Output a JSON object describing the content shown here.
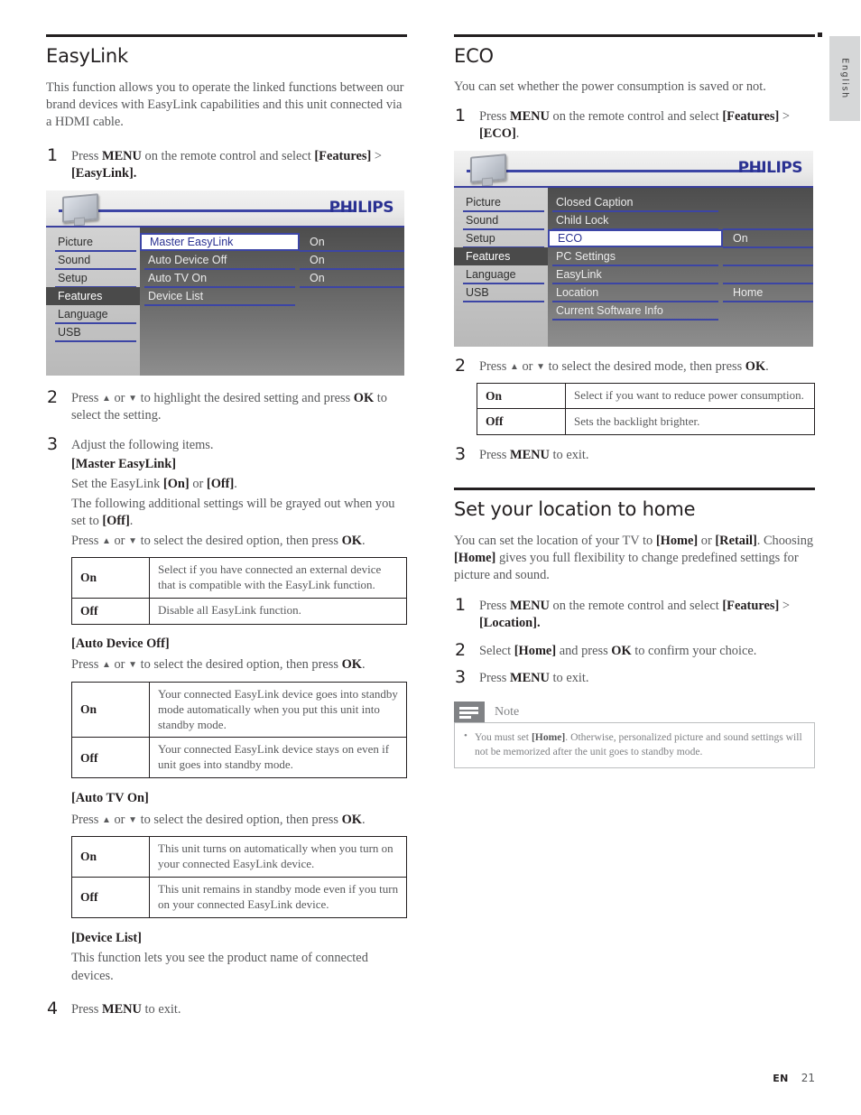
{
  "page": {
    "language_tab": "English",
    "footer_lang": "EN",
    "footer_page": "21"
  },
  "left_column": {
    "section_title": "EasyLink",
    "intro": "This function allows you to operate the linked functions between our brand devices with EasyLink capabilities and this unit connected via a HDMI cable.",
    "step1": {
      "num": "1",
      "text_1": "Press ",
      "menu": "MENU",
      "text_2": " on the remote control and select ",
      "features": "[Features]",
      "text_3": " > ",
      "easylink": "[EasyLink]."
    },
    "osd": {
      "brand": "PHILIPS",
      "left_menu": [
        "Picture",
        "Sound",
        "Setup",
        "Features",
        "Language",
        "USB"
      ],
      "left_selected": "Features",
      "mid_menu": [
        "Master EasyLink",
        "Auto Device Off",
        "Auto TV On",
        "Device List"
      ],
      "mid_highlighted": "Master EasyLink",
      "right_values": [
        "On",
        "On",
        "On",
        ""
      ]
    },
    "step2": {
      "num": "2",
      "text_1": "Press ",
      "up": "▲",
      "text_2": " or ",
      "down": "▼",
      "text_3": " to highlight the desired setting and press ",
      "ok": "OK",
      "text_4": " to select the setting."
    },
    "step3": {
      "num": "3",
      "lead": "Adjust the following items.",
      "master_heading": "[Master EasyLink]",
      "master_line1_a": "Set the EasyLink ",
      "master_line1_on": "[On]",
      "master_line1_b": " or ",
      "master_line1_off": "[Off]",
      "master_line1_c": ".",
      "master_line2_a": "The following additional settings will be grayed out when you set to ",
      "master_line2_off": "[Off]",
      "master_line2_b": ".",
      "press_line_a": "Press ",
      "press_up": "▲",
      "press_line_b": " or ",
      "press_down": "▼",
      "press_line_c": " to select the desired option, then press ",
      "press_ok": "OK",
      "press_line_d": ".",
      "master_table": [
        {
          "key": "On",
          "desc": "Select if you have connected an external device that is compatible with the EasyLink function."
        },
        {
          "key": "Off",
          "desc": "Disable all EasyLink function."
        }
      ],
      "auto_device_off_heading": "[Auto Device Off]",
      "auto_device_off_table": [
        {
          "key": "On",
          "desc": "Your connected EasyLink device goes into standby mode automatically when you put this unit into standby mode."
        },
        {
          "key": "Off",
          "desc": "Your connected EasyLink device stays on even if unit goes into standby mode."
        }
      ],
      "auto_tv_on_heading": "[Auto TV On]",
      "auto_tv_on_table": [
        {
          "key": "On",
          "desc": "This unit turns on automatically when you turn on your connected EasyLink device."
        },
        {
          "key": "Off",
          "desc": "This unit remains in standby mode even if you turn on your connected EasyLink device."
        }
      ],
      "device_list_heading": "[Device List]",
      "device_list_text": "This function lets you see the product name of connected devices."
    },
    "step4": {
      "num": "4",
      "text_1": "Press ",
      "menu": "MENU",
      "text_2": " to exit."
    }
  },
  "right_column": {
    "eco": {
      "section_title": "ECO",
      "intro": "You can set whether the power consumption is saved or not.",
      "step1": {
        "num": "1",
        "text_1": "Press ",
        "menu": "MENU",
        "text_2": " on the remote control and select ",
        "features": "[Features]",
        "text_3": " > ",
        "eco": "[ECO]",
        "text_4": "."
      },
      "osd": {
        "brand": "PHILIPS",
        "left_menu": [
          "Picture",
          "Sound",
          "Setup",
          "Features",
          "Language",
          "USB"
        ],
        "left_selected": "Features",
        "mid_menu": [
          "Closed Caption",
          "Child Lock",
          "ECO",
          "PC Settings",
          "EasyLink",
          "Location",
          "Current Software Info"
        ],
        "mid_highlighted": "ECO",
        "right_values": [
          "",
          "",
          "On",
          "",
          "",
          "Home",
          ""
        ]
      },
      "step2": {
        "num": "2",
        "text_1": "Press ",
        "up": "▲",
        "text_2": " or ",
        "down": "▼",
        "text_3": " to select the desired mode, then press ",
        "ok": "OK",
        "text_4": "."
      },
      "table": [
        {
          "key": "On",
          "desc": "Select if you want to reduce power consumption."
        },
        {
          "key": "Off",
          "desc": "Sets the backlight brighter."
        }
      ],
      "step3": {
        "num": "3",
        "text_1": "Press ",
        "menu": "MENU",
        "text_2": " to exit."
      }
    },
    "location": {
      "section_title": "Set your location to home",
      "intro_a": "You can set the location of your TV to ",
      "intro_home1": "[Home]",
      "intro_b": " or ",
      "intro_retail": "[Retail]",
      "intro_c": ". Choosing ",
      "intro_home2": "[Home]",
      "intro_d": " gives you full flexibility to change predefined settings for picture and sound.",
      "step1": {
        "num": "1",
        "text_1": "Press ",
        "menu": "MENU",
        "text_2": " on the remote control and select ",
        "features": "[Features]",
        "text_3": " > ",
        "location": "[Location]."
      },
      "step2": {
        "num": "2",
        "text_1": "Select ",
        "home": "[Home]",
        "text_2": " and press ",
        "ok": "OK",
        "text_3": " to confirm your choice."
      },
      "step3": {
        "num": "3",
        "text_1": "Press ",
        "menu": "MENU",
        "text_2": " to exit."
      },
      "note": {
        "label": "Note",
        "bullet_a": "You must set ",
        "bullet_home": "[Home]",
        "bullet_b": ". Otherwise, personalized picture and sound settings will not be memorized after the unit goes to standby mode."
      }
    }
  },
  "colors": {
    "brand_blue": "#2a3192",
    "osd_line_blue": "#3c45a5",
    "text": "#231f20",
    "body_text": "#58595b"
  }
}
